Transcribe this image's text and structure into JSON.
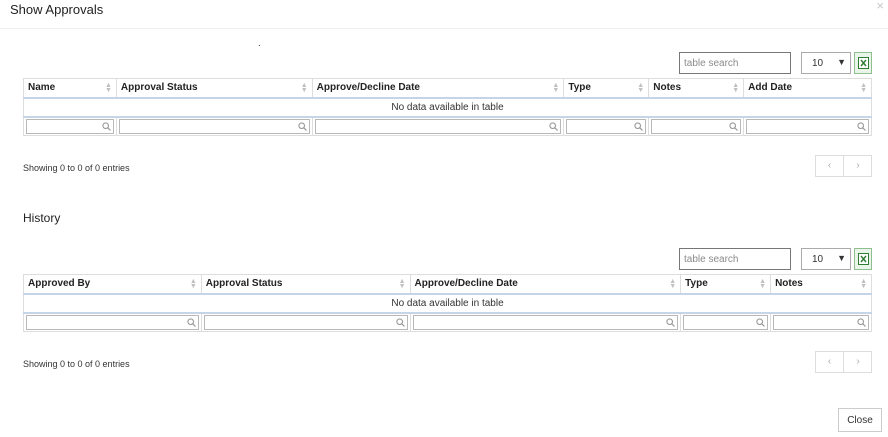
{
  "modal": {
    "title": "Show Approvals",
    "close_glyph": "×",
    "close_button_label": "Close",
    "dot": "."
  },
  "approvals": {
    "search_placeholder": "table search",
    "page_length": "10",
    "columns": [
      "Name",
      "Approval Status",
      "Approve/Decline Date",
      "Type",
      "Notes",
      "Add Date"
    ],
    "empty_message": "No data available in table",
    "info": "Showing 0 to 0 of 0 entries",
    "prev": "‹",
    "next": "›"
  },
  "history": {
    "title": "History",
    "search_placeholder": "table search",
    "page_length": "10",
    "columns": [
      "Approved By",
      "Approval Status",
      "Approve/Decline Date",
      "Type",
      "Notes"
    ],
    "empty_message": "No data available in table",
    "info": "Showing 0 to 0 of 0 entries",
    "prev": "‹",
    "next": "›"
  },
  "icons": {
    "search": "search-icon",
    "excel": "excel-icon",
    "sort": "sort-icon",
    "dropdown": "chevron-down-icon"
  }
}
